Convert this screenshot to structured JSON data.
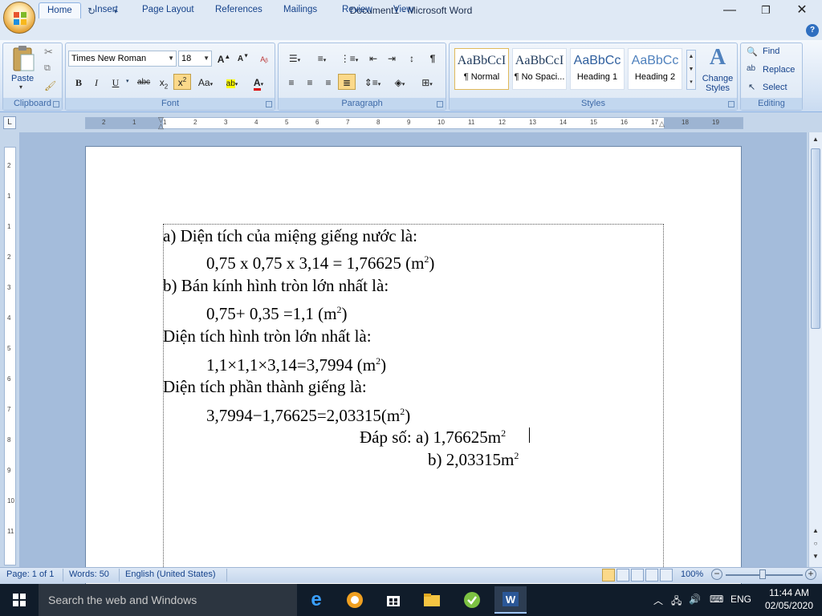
{
  "window": {
    "title": "Document1 - Microsoft Word"
  },
  "tabs": [
    "Home",
    "Insert",
    "Page Layout",
    "References",
    "Mailings",
    "Review",
    "View"
  ],
  "ribbon": {
    "clipboard": {
      "label": "Clipboard",
      "paste": "Paste"
    },
    "font": {
      "label": "Font",
      "name": "Times New Roman",
      "size": "18"
    },
    "paragraph": {
      "label": "Paragraph"
    },
    "styles": {
      "label": "Styles",
      "items": [
        {
          "preview": "AaBbCcI",
          "name": "¶ Normal",
          "color": "#000000"
        },
        {
          "preview": "AaBbCcI",
          "name": "¶ No Spaci...",
          "color": "#000000"
        },
        {
          "preview": "AaBbCc",
          "name": "Heading 1",
          "color": "#2f5f9e"
        },
        {
          "preview": "AaBbCc",
          "name": "Heading 2",
          "color": "#4f81bd"
        }
      ],
      "change_styles": "Change Styles"
    },
    "editing": {
      "label": "Editing",
      "find": "Find",
      "replace": "Replace",
      "select": "Select"
    }
  },
  "ruler": {
    "h_numbers": [
      "2",
      "1",
      "1",
      "2",
      "3",
      "4",
      "5",
      "6",
      "7",
      "8",
      "9",
      "10",
      "11",
      "12",
      "13",
      "14",
      "15",
      "16",
      "17",
      "18",
      "19"
    ],
    "v_numbers": [
      "2",
      "1",
      "1",
      "2",
      "3",
      "4",
      "5",
      "6",
      "7",
      "8",
      "9",
      "10",
      "11"
    ]
  },
  "document": {
    "lines": [
      {
        "text": "a) Diện tích của miệng giếng nước là:",
        "sup": "",
        "after": ""
      },
      {
        "text": "0,75 x 0,75 x 3,14 = 1,76625 (m",
        "sup": "2",
        "after": ")"
      },
      {
        "text": "b) Bán kính hình tròn lớn nhất là:",
        "sup": "",
        "after": ""
      },
      {
        "text": "0,75+ 0,35 =1,1 (m",
        "sup": "2",
        "after": ")"
      },
      {
        "text": "Diện tích hình tròn lớn nhất là:",
        "sup": "",
        "after": ""
      },
      {
        "text": "1,1×1,1×3,14=3,7994 (m",
        "sup": "2",
        "after": ")"
      },
      {
        "text": "Diện tích phần thành giếng là:",
        "sup": "",
        "after": ""
      },
      {
        "text": "3,7994−1,76625=2,03315(m",
        "sup": "2",
        "after": ")"
      },
      {
        "text": "Đáp số: a) 1,76625m",
        "sup": "2",
        "after": ""
      },
      {
        "text": "b) 2,03315m",
        "sup": "2",
        "after": ""
      }
    ]
  },
  "status": {
    "page": "Page: 1 of 1",
    "words": "Words: 50",
    "language": "English (United States)",
    "zoom": "100%"
  },
  "taskbar": {
    "search_placeholder": "Search the web and Windows",
    "language": "ENG",
    "time": "11:44 AM",
    "date": "02/05/2020"
  }
}
